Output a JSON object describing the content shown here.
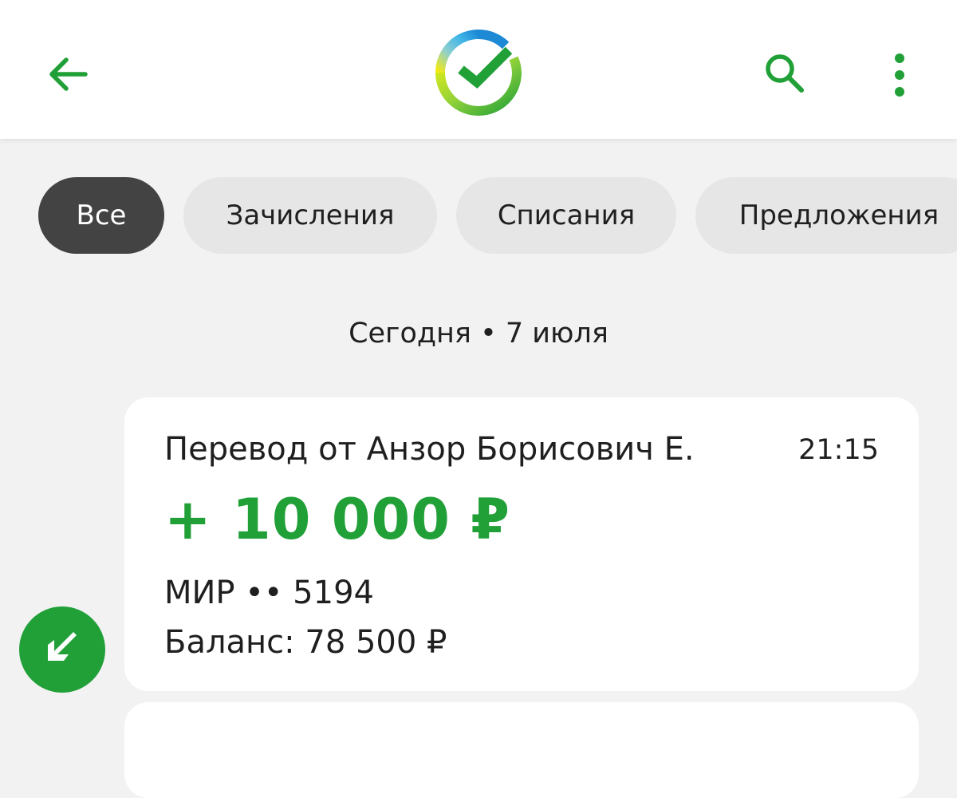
{
  "header": {
    "back_icon": "arrow-left-icon",
    "logo_icon": "sber-logo-icon",
    "search_icon": "search-icon",
    "menu_icon": "more-vertical-icon",
    "accent_color": "#21a038"
  },
  "filters": {
    "chips": [
      {
        "label": "Все",
        "active": true
      },
      {
        "label": "Зачисления",
        "active": false
      },
      {
        "label": "Списания",
        "active": false
      },
      {
        "label": "Предложения",
        "active": false
      }
    ]
  },
  "feed": {
    "date_header": "Сегодня • 7 июля",
    "transactions": [
      {
        "title": "Перевод от Анзор Борисович Е.",
        "time": "21:15",
        "amount": "+ 10 000 ₽",
        "card": "МИР •• 5194",
        "balance": "Баланс: 78 500 ₽",
        "direction_icon": "arrow-down-left-icon"
      }
    ]
  }
}
